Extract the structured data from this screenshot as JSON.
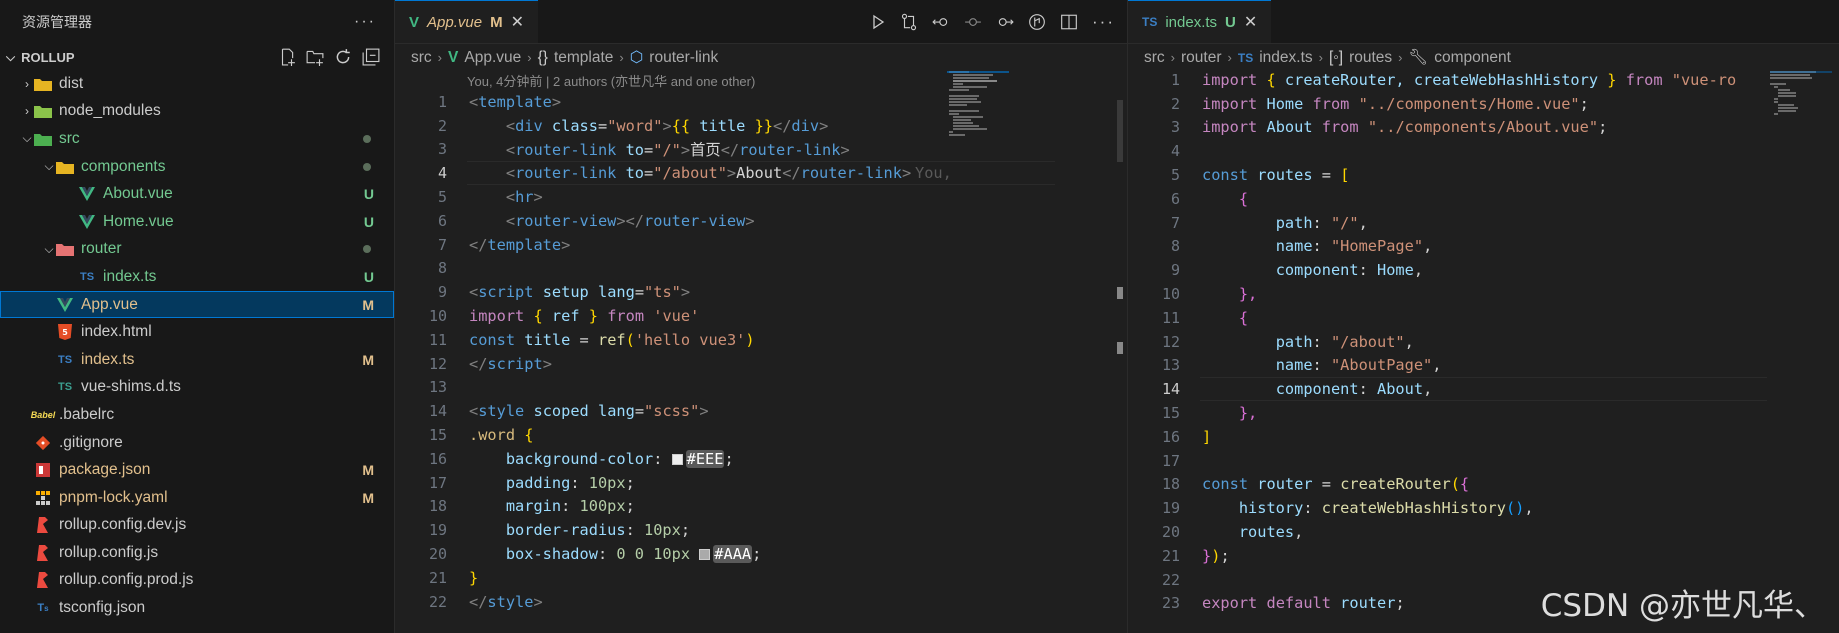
{
  "explorer": {
    "title": "资源管理器",
    "section": "ROLLUP",
    "items": [
      {
        "label": "dist",
        "depth": 0,
        "type": "folder",
        "open": false,
        "icon": "folder-dist-icon",
        "color": "#cccccc",
        "status": "",
        "dot": false
      },
      {
        "label": "node_modules",
        "depth": 0,
        "type": "folder",
        "open": false,
        "icon": "folder-node-icon",
        "color": "#cccccc",
        "status": "",
        "dot": false
      },
      {
        "label": "src",
        "depth": 0,
        "type": "folder",
        "open": true,
        "icon": "folder-src-icon",
        "color": "#73c991",
        "status": "",
        "dot": true
      },
      {
        "label": "components",
        "depth": 1,
        "type": "folder",
        "open": true,
        "icon": "folder-components-icon",
        "color": "#73c991",
        "status": "",
        "dot": true
      },
      {
        "label": "About.vue",
        "depth": 2,
        "type": "vue",
        "icon": "vue-file-icon",
        "color": "#73c991",
        "status": "U",
        "dot": false
      },
      {
        "label": "Home.vue",
        "depth": 2,
        "type": "vue",
        "icon": "vue-file-icon",
        "color": "#73c991",
        "status": "U",
        "dot": false
      },
      {
        "label": "router",
        "depth": 1,
        "type": "folder",
        "open": true,
        "icon": "folder-router-icon",
        "color": "#73c991",
        "status": "",
        "dot": true
      },
      {
        "label": "index.ts",
        "depth": 2,
        "type": "ts",
        "icon": "typescript-file-icon",
        "color": "#73c991",
        "status": "U",
        "dot": false
      },
      {
        "label": "App.vue",
        "depth": 1,
        "type": "vue",
        "icon": "vue-file-icon",
        "color": "#e2c08d",
        "status": "M",
        "dot": false,
        "selected": true
      },
      {
        "label": "index.html",
        "depth": 1,
        "type": "html",
        "icon": "html-file-icon",
        "color": "#cccccc",
        "status": "",
        "dot": false
      },
      {
        "label": "index.ts",
        "depth": 1,
        "type": "ts",
        "icon": "typescript-file-icon",
        "color": "#e2c08d",
        "status": "M",
        "dot": false
      },
      {
        "label": "vue-shims.d.ts",
        "depth": 1,
        "type": "dts",
        "icon": "typescript-def-icon",
        "color": "#cccccc",
        "status": "",
        "dot": false
      },
      {
        "label": ".babelrc",
        "depth": 0,
        "type": "babel",
        "icon": "babel-file-icon",
        "color": "#cccccc",
        "status": "",
        "dot": false
      },
      {
        "label": ".gitignore",
        "depth": 0,
        "type": "git",
        "icon": "git-file-icon",
        "color": "#cccccc",
        "status": "",
        "dot": false
      },
      {
        "label": "package.json",
        "depth": 0,
        "type": "npm",
        "icon": "npm-file-icon",
        "color": "#e2c08d",
        "status": "M",
        "dot": false
      },
      {
        "label": "pnpm-lock.yaml",
        "depth": 0,
        "type": "pnpm",
        "icon": "pnpm-file-icon",
        "color": "#e2c08d",
        "status": "M",
        "dot": false
      },
      {
        "label": "rollup.config.dev.js",
        "depth": 0,
        "type": "rollup",
        "icon": "rollup-file-icon",
        "color": "#cccccc",
        "status": "",
        "dot": false
      },
      {
        "label": "rollup.config.js",
        "depth": 0,
        "type": "rollup",
        "icon": "rollup-file-icon",
        "color": "#cccccc",
        "status": "",
        "dot": false
      },
      {
        "label": "rollup.config.prod.js",
        "depth": 0,
        "type": "rollup",
        "icon": "rollup-file-icon",
        "color": "#cccccc",
        "status": "",
        "dot": false
      },
      {
        "label": "tsconfig.json",
        "depth": 0,
        "type": "tsconfig",
        "icon": "tsconfig-file-icon",
        "color": "#cccccc",
        "status": "",
        "dot": false
      }
    ]
  },
  "editor1": {
    "tab": {
      "name": "App.vue",
      "mod": "M"
    },
    "breadcrumbs": [
      "src",
      "App.vue",
      "template",
      "router-link"
    ],
    "codelens": "You, 4分钟前 | 2 authors (亦世凡华 and one other)",
    "active_line": 4,
    "blame": "You,",
    "lines": [
      [
        [
          "<",
          "tk-gray"
        ],
        [
          "template",
          "tk-tag"
        ],
        [
          ">",
          "tk-gray"
        ]
      ],
      [
        [
          "    ",
          ""
        ],
        [
          "<",
          "tk-gray"
        ],
        [
          "div",
          "tk-tag"
        ],
        [
          " ",
          ""
        ],
        [
          "class",
          "tk-attr"
        ],
        [
          "=",
          "tk-txt"
        ],
        [
          "\"word\"",
          "tk-str"
        ],
        [
          ">",
          "tk-gray"
        ],
        [
          "{{",
          "tk-brk1"
        ],
        [
          " title ",
          "tk-var"
        ],
        [
          "}}",
          "tk-brk1"
        ],
        [
          "</",
          "tk-gray"
        ],
        [
          "div",
          "tk-tag"
        ],
        [
          ">",
          "tk-gray"
        ]
      ],
      [
        [
          "    ",
          ""
        ],
        [
          "<",
          "tk-gray"
        ],
        [
          "router-link",
          "tk-tag"
        ],
        [
          " ",
          ""
        ],
        [
          "to",
          "tk-attr"
        ],
        [
          "=",
          "tk-txt"
        ],
        [
          "\"/\"",
          "tk-str"
        ],
        [
          ">",
          "tk-gray"
        ],
        [
          "首页",
          "tk-txt"
        ],
        [
          "</",
          "tk-gray"
        ],
        [
          "router-link",
          "tk-tag"
        ],
        [
          ">",
          "tk-gray"
        ]
      ],
      [
        [
          "    ",
          ""
        ],
        [
          "<",
          "tk-gray"
        ],
        [
          "router-link",
          "tk-tag"
        ],
        [
          " ",
          ""
        ],
        [
          "to",
          "tk-attr"
        ],
        [
          "=",
          "tk-txt"
        ],
        [
          "\"/about\"",
          "tk-str"
        ],
        [
          ">",
          "tk-gray"
        ],
        [
          "About",
          "tk-txt"
        ],
        [
          "</",
          "tk-gray"
        ],
        [
          "router-link",
          "tk-tag"
        ],
        [
          ">",
          "tk-gray"
        ]
      ],
      [
        [
          "    ",
          ""
        ],
        [
          "<",
          "tk-gray"
        ],
        [
          "hr",
          "tk-tag"
        ],
        [
          ">",
          "tk-gray"
        ]
      ],
      [
        [
          "    ",
          ""
        ],
        [
          "<",
          "tk-gray"
        ],
        [
          "router-view",
          "tk-tag"
        ],
        [
          "></",
          "tk-gray"
        ],
        [
          "router-view",
          "tk-tag"
        ],
        [
          ">",
          "tk-gray"
        ]
      ],
      [
        [
          "</",
          "tk-gray"
        ],
        [
          "template",
          "tk-tag"
        ],
        [
          ">",
          "tk-gray"
        ]
      ],
      [],
      [
        [
          "<",
          "tk-gray"
        ],
        [
          "script",
          "tk-tag"
        ],
        [
          " ",
          ""
        ],
        [
          "setup",
          "tk-attr"
        ],
        [
          " ",
          ""
        ],
        [
          "lang",
          "tk-attr"
        ],
        [
          "=",
          "tk-txt"
        ],
        [
          "\"ts\"",
          "tk-str"
        ],
        [
          ">",
          "tk-gray"
        ]
      ],
      [
        [
          "import",
          "tk-kw"
        ],
        [
          " ",
          ""
        ],
        [
          "{",
          "tk-brk1"
        ],
        [
          " ref ",
          "tk-var"
        ],
        [
          "}",
          "tk-brk1"
        ],
        [
          " ",
          ""
        ],
        [
          "from",
          "tk-kw"
        ],
        [
          " ",
          ""
        ],
        [
          "'vue'",
          "tk-str"
        ]
      ],
      [
        [
          "const",
          "tk-kw2"
        ],
        [
          " ",
          ""
        ],
        [
          "title",
          "tk-var"
        ],
        [
          " = ",
          "tk-txt"
        ],
        [
          "ref",
          "tk-fn"
        ],
        [
          "(",
          "tk-brk1"
        ],
        [
          "'hello vue3'",
          "tk-str"
        ],
        [
          ")",
          "tk-brk1"
        ]
      ],
      [
        [
          "</",
          "tk-gray"
        ],
        [
          "script",
          "tk-tag"
        ],
        [
          ">",
          "tk-gray"
        ]
      ],
      [],
      [
        [
          "<",
          "tk-gray"
        ],
        [
          "style",
          "tk-tag"
        ],
        [
          " ",
          ""
        ],
        [
          "scoped",
          "tk-attr"
        ],
        [
          " ",
          ""
        ],
        [
          "lang",
          "tk-attr"
        ],
        [
          "=",
          "tk-txt"
        ],
        [
          "\"scss\"",
          "tk-str"
        ],
        [
          ">",
          "tk-gray"
        ]
      ],
      [
        [
          ".word",
          "tk-sel"
        ],
        [
          " ",
          ""
        ],
        [
          "{",
          "tk-brk1"
        ]
      ],
      [
        [
          "    ",
          ""
        ],
        [
          "background-color",
          "tk-prop"
        ],
        [
          ": ",
          "tk-txt"
        ],
        [
          "SWATCH:#eeeeee",
          ""
        ],
        [
          "#EEE",
          "tk-col"
        ],
        [
          ";",
          "tk-txt"
        ]
      ],
      [
        [
          "    ",
          ""
        ],
        [
          "padding",
          "tk-prop"
        ],
        [
          ": ",
          "tk-txt"
        ],
        [
          "10px",
          "tk-num"
        ],
        [
          ";",
          "tk-txt"
        ]
      ],
      [
        [
          "    ",
          ""
        ],
        [
          "margin",
          "tk-prop"
        ],
        [
          ": ",
          "tk-txt"
        ],
        [
          "100px",
          "tk-num"
        ],
        [
          ";",
          "tk-txt"
        ]
      ],
      [
        [
          "    ",
          ""
        ],
        [
          "border-radius",
          "tk-prop"
        ],
        [
          ": ",
          "tk-txt"
        ],
        [
          "10px",
          "tk-num"
        ],
        [
          ";",
          "tk-txt"
        ]
      ],
      [
        [
          "    ",
          ""
        ],
        [
          "box-shadow",
          "tk-prop"
        ],
        [
          ": ",
          "tk-txt"
        ],
        [
          "0 0 10px",
          "tk-num"
        ],
        [
          " ",
          ""
        ],
        [
          "SWATCH:#aaaaaa",
          ""
        ],
        [
          "#AAA",
          "tk-col"
        ],
        [
          ";",
          "tk-txt"
        ]
      ],
      [
        [
          "}",
          "tk-brk1"
        ]
      ],
      [
        [
          "</",
          "tk-gray"
        ],
        [
          "style",
          "tk-tag"
        ],
        [
          ">",
          "tk-gray"
        ]
      ]
    ]
  },
  "editor2": {
    "tab": {
      "name": "index.ts",
      "mod": "U",
      "prefix": "TS"
    },
    "breadcrumbs": [
      "src",
      "router",
      "index.ts",
      "routes",
      "component"
    ],
    "active_line": 14,
    "lines": [
      [
        [
          "import",
          "tk-kw"
        ],
        [
          " ",
          ""
        ],
        [
          "{",
          "tk-brk1"
        ],
        [
          " createRouter, createWebHashHistory ",
          "tk-var"
        ],
        [
          "}",
          "tk-brk1"
        ],
        [
          " ",
          ""
        ],
        [
          "from",
          "tk-kw"
        ],
        [
          " ",
          ""
        ],
        [
          "\"vue-ro",
          "tk-str"
        ]
      ],
      [
        [
          "import",
          "tk-kw"
        ],
        [
          " ",
          ""
        ],
        [
          "Home",
          "tk-var"
        ],
        [
          " ",
          ""
        ],
        [
          "from",
          "tk-kw"
        ],
        [
          " ",
          ""
        ],
        [
          "\"../components/Home.vue\"",
          "tk-str"
        ],
        [
          ";",
          "tk-txt"
        ]
      ],
      [
        [
          "import",
          "tk-kw"
        ],
        [
          " ",
          ""
        ],
        [
          "About",
          "tk-var"
        ],
        [
          " ",
          ""
        ],
        [
          "from",
          "tk-kw"
        ],
        [
          " ",
          ""
        ],
        [
          "\"../components/About.vue\"",
          "tk-str"
        ],
        [
          ";",
          "tk-txt"
        ]
      ],
      [],
      [
        [
          "const",
          "tk-kw2"
        ],
        [
          " ",
          ""
        ],
        [
          "routes",
          "tk-var"
        ],
        [
          " = ",
          "tk-txt"
        ],
        [
          "[",
          "tk-brk1"
        ]
      ],
      [
        [
          "    ",
          ""
        ],
        [
          "{",
          "tk-brk2"
        ]
      ],
      [
        [
          "        ",
          ""
        ],
        [
          "path",
          "tk-prop"
        ],
        [
          ": ",
          "tk-txt"
        ],
        [
          "\"/\"",
          "tk-str"
        ],
        [
          ",",
          "tk-txt"
        ]
      ],
      [
        [
          "        ",
          ""
        ],
        [
          "name",
          "tk-prop"
        ],
        [
          ": ",
          "tk-txt"
        ],
        [
          "\"HomePage\"",
          "tk-str"
        ],
        [
          ",",
          "tk-txt"
        ]
      ],
      [
        [
          "        ",
          ""
        ],
        [
          "component",
          "tk-prop"
        ],
        [
          ": ",
          "tk-txt"
        ],
        [
          "Home",
          "tk-var"
        ],
        [
          ",",
          "tk-txt"
        ]
      ],
      [
        [
          "    ",
          ""
        ],
        [
          "},",
          "tk-brk2"
        ]
      ],
      [
        [
          "    ",
          ""
        ],
        [
          "{",
          "tk-brk2"
        ]
      ],
      [
        [
          "        ",
          ""
        ],
        [
          "path",
          "tk-prop"
        ],
        [
          ": ",
          "tk-txt"
        ],
        [
          "\"/about\"",
          "tk-str"
        ],
        [
          ",",
          "tk-txt"
        ]
      ],
      [
        [
          "        ",
          ""
        ],
        [
          "name",
          "tk-prop"
        ],
        [
          ": ",
          "tk-txt"
        ],
        [
          "\"AboutPage\"",
          "tk-str"
        ],
        [
          ",",
          "tk-txt"
        ]
      ],
      [
        [
          "        ",
          ""
        ],
        [
          "component",
          "tk-prop"
        ],
        [
          ": ",
          "tk-txt"
        ],
        [
          "About",
          "tk-var"
        ],
        [
          ",",
          "tk-txt"
        ]
      ],
      [
        [
          "    ",
          ""
        ],
        [
          "},",
          "tk-brk2"
        ]
      ],
      [
        [
          "]",
          "tk-brk1"
        ]
      ],
      [],
      [
        [
          "const",
          "tk-kw2"
        ],
        [
          " ",
          ""
        ],
        [
          "router",
          "tk-var"
        ],
        [
          " = ",
          "tk-txt"
        ],
        [
          "createRouter",
          "tk-fn"
        ],
        [
          "(",
          "tk-brk1"
        ],
        [
          "{",
          "tk-brk2"
        ]
      ],
      [
        [
          "    ",
          ""
        ],
        [
          "history",
          "tk-prop"
        ],
        [
          ": ",
          "tk-txt"
        ],
        [
          "createWebHashHistory",
          "tk-fn"
        ],
        [
          "()",
          "tk-brk3"
        ],
        [
          ",",
          "tk-txt"
        ]
      ],
      [
        [
          "    ",
          ""
        ],
        [
          "routes",
          "tk-var"
        ],
        [
          ",",
          "tk-txt"
        ]
      ],
      [
        [
          "}",
          "tk-brk2"
        ],
        [
          ")",
          "tk-brk1"
        ],
        [
          ";",
          "tk-txt"
        ]
      ],
      [],
      [
        [
          "export",
          "tk-kw"
        ],
        [
          " ",
          ""
        ],
        [
          "default",
          "tk-kw"
        ],
        [
          " ",
          ""
        ],
        [
          "router",
          "tk-var"
        ],
        [
          ";",
          "tk-txt"
        ]
      ]
    ]
  },
  "watermark": "CSDN @亦世凡华、"
}
